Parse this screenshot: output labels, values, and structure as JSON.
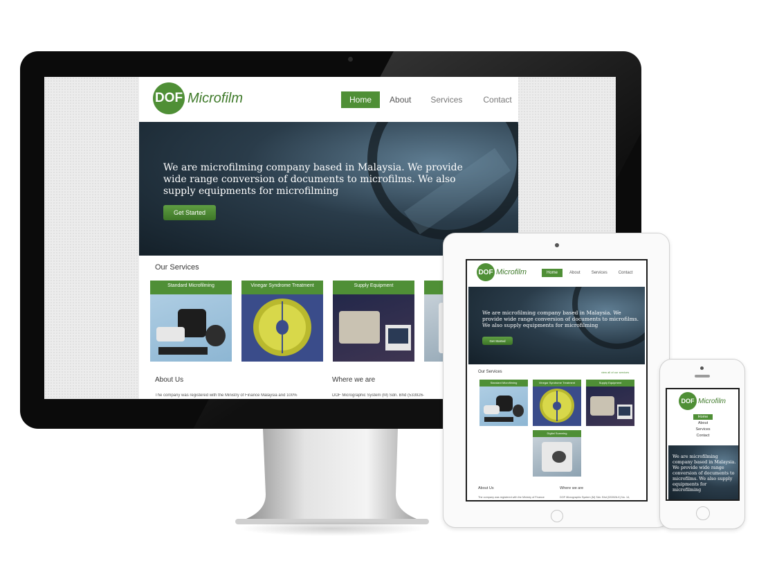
{
  "brand": {
    "logo_mark": "DOF",
    "logo_name": "Microfilm",
    "green": "#4f8f36"
  },
  "nav": {
    "items": [
      "Home",
      "About",
      "Services",
      "Contact"
    ],
    "active": "Home"
  },
  "hero": {
    "text": "We are microfilming company based in Malaysia. We provide wide range conversion of documents to microfilms. We also supply equipments for microfilming",
    "button": "Get Started"
  },
  "services": {
    "title": "Our Services",
    "view_all": "view all of our services",
    "items": [
      "Standard Microfilming",
      "Vinegar Syndrome Treatment",
      "Supply Equipment",
      "Digital Scanning"
    ]
  },
  "about": {
    "title": "About Us",
    "text_desktop": "The company was registered with the Ministry of Finance Malaysia and 100%",
    "text_tablet": "The company was registered with the Ministry of Finance"
  },
  "where": {
    "title": "Where we are",
    "text_desktop": "DOF Micrographic System (M) Sdn. Bhd (533926-",
    "text_tablet": "DOF Micrographic System (M) Sdn. Bhd (533926-K) No. 14,"
  }
}
